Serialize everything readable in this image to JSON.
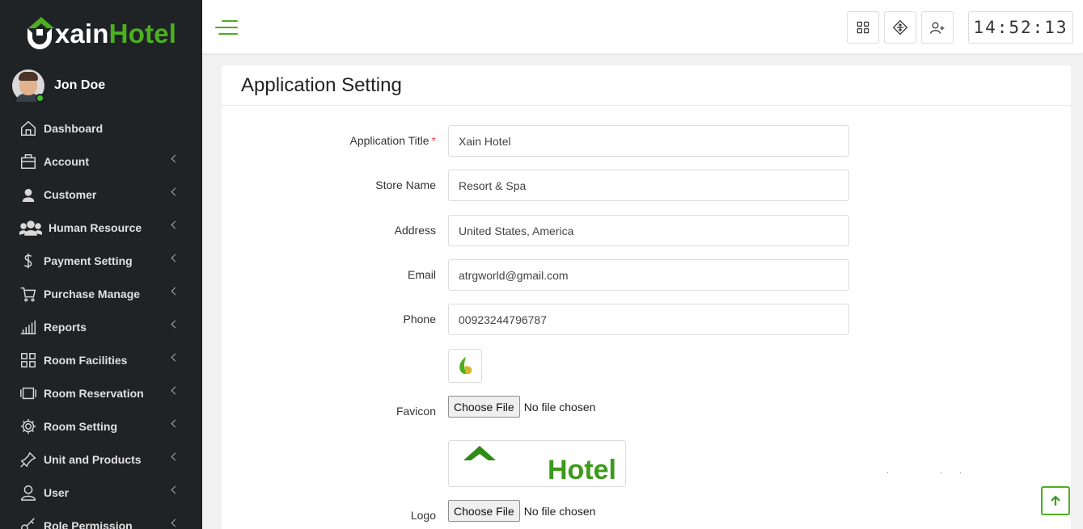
{
  "brand": {
    "part1": "xain",
    "part2": "Hotel"
  },
  "user": {
    "name": "Jon Doe"
  },
  "sidebar": {
    "items": [
      {
        "label": "Dashboard",
        "icon": "home-icon"
      },
      {
        "label": "Account",
        "icon": "briefcase-icon"
      },
      {
        "label": "Customer",
        "icon": "user-icon"
      },
      {
        "label": "Human Resource",
        "icon": "users-icon"
      },
      {
        "label": "Payment Setting",
        "icon": "dollar-icon"
      },
      {
        "label": "Purchase Manage",
        "icon": "cart-icon"
      },
      {
        "label": "Reports",
        "icon": "bar-chart-icon"
      },
      {
        "label": "Room Facilities",
        "icon": "grid-icon"
      },
      {
        "label": "Room Reservation",
        "icon": "film-icon"
      },
      {
        "label": "Room Setting",
        "icon": "gear-icon"
      },
      {
        "label": "Unit and Products",
        "icon": "pin-icon"
      },
      {
        "label": "User",
        "icon": "person-icon"
      },
      {
        "label": "Role Permission",
        "icon": "key-icon"
      }
    ]
  },
  "topbar": {
    "clock": "14:52:13",
    "buttons": [
      "grid-icon",
      "move-icon",
      "add-user-icon"
    ]
  },
  "page": {
    "title": "Application Setting",
    "fields": {
      "app_title": {
        "label": "Application Title",
        "required": "*",
        "value": "Xain Hotel"
      },
      "store_name": {
        "label": "Store Name",
        "value": "Resort & Spa"
      },
      "address": {
        "label": "Address",
        "value": "United States, America"
      },
      "email": {
        "label": "Email",
        "value": "atrgworld@gmail.com"
      },
      "phone": {
        "label": "Phone",
        "value": "00923244796787"
      }
    },
    "favicon": {
      "label": "Favicon",
      "button": "Choose File",
      "status": "No file chosen"
    },
    "logo": {
      "label": "Logo",
      "button": "Choose File",
      "status": "No file chosen",
      "preview_text": "Hotel"
    }
  },
  "colors": {
    "accent": "#4caf1f",
    "sidebar_bg": "#1f2326",
    "required": "#e24c4b"
  }
}
